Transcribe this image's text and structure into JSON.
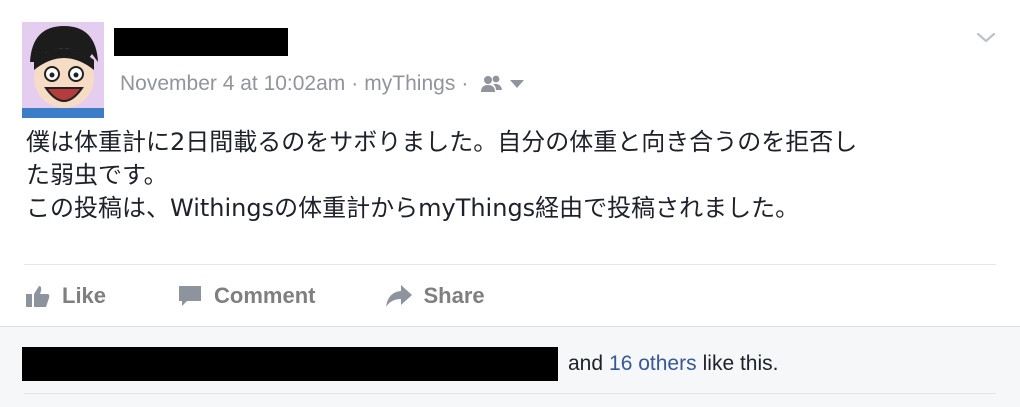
{
  "post": {
    "author_name": "",
    "timestamp": "November 4 at 10:02am",
    "separator": "·",
    "app_name": "myThings",
    "audience_icon": "friends-icon",
    "text_lines": [
      "僕は体重計に2日間載るのをサボりました。自分の体重と向き合うのを拒否し",
      "た弱虫です。",
      "この投稿は、Withingsの体重計からmyThings経由で投稿されました。"
    ]
  },
  "actions": {
    "like_label": "Like",
    "comment_label": "Comment",
    "share_label": "Share"
  },
  "likes": {
    "and_text": "and",
    "others_link": "16 others",
    "suffix": "like this."
  },
  "colors": {
    "link": "#365899",
    "meta": "#90949c",
    "text": "#1d2129",
    "footer_bg": "#f6f7f9"
  }
}
